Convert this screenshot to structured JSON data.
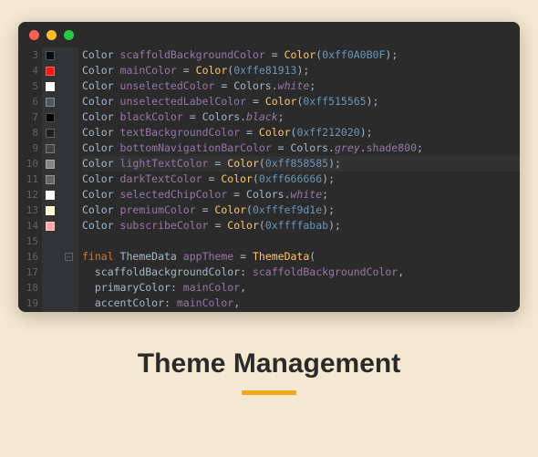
{
  "caption": "Theme Management",
  "lines": [
    {
      "num": "3",
      "swatch": "#0A0B0F",
      "code": [
        {
          "c": "type",
          "t": "Color "
        },
        {
          "c": "ident",
          "t": "scaffoldBackgroundColor"
        },
        {
          "c": "eq",
          "t": " = "
        },
        {
          "c": "call",
          "t": "Color"
        },
        {
          "c": "punc",
          "t": "("
        },
        {
          "c": "num",
          "t": "0xff0A0B0F"
        },
        {
          "c": "punc",
          "t": ");"
        }
      ]
    },
    {
      "num": "4",
      "swatch": "#f81913",
      "code": [
        {
          "c": "type",
          "t": "Color "
        },
        {
          "c": "ident",
          "t": "mainColor"
        },
        {
          "c": "eq",
          "t": " = "
        },
        {
          "c": "call",
          "t": "Color"
        },
        {
          "c": "punc",
          "t": "("
        },
        {
          "c": "num",
          "t": "0xffe81913"
        },
        {
          "c": "punc",
          "t": ");"
        }
      ]
    },
    {
      "num": "5",
      "swatch": "#ffffff",
      "code": [
        {
          "c": "type",
          "t": "Color "
        },
        {
          "c": "ident",
          "t": "unselectedColor"
        },
        {
          "c": "eq",
          "t": " = "
        },
        {
          "c": "obj",
          "t": "Colors."
        },
        {
          "c": "prop",
          "t": "white"
        },
        {
          "c": "punc",
          "t": ";"
        }
      ]
    },
    {
      "num": "6",
      "swatch": "#515565",
      "code": [
        {
          "c": "type",
          "t": "Color "
        },
        {
          "c": "ident",
          "t": "unselectedLabelColor"
        },
        {
          "c": "eq",
          "t": " = "
        },
        {
          "c": "call",
          "t": "Color"
        },
        {
          "c": "punc",
          "t": "("
        },
        {
          "c": "num",
          "t": "0xff515565"
        },
        {
          "c": "punc",
          "t": ");"
        }
      ]
    },
    {
      "num": "7",
      "swatch": "#000000",
      "code": [
        {
          "c": "type",
          "t": "Color "
        },
        {
          "c": "ident",
          "t": "blackColor"
        },
        {
          "c": "eq",
          "t": " = "
        },
        {
          "c": "obj",
          "t": "Colors."
        },
        {
          "c": "prop",
          "t": "black"
        },
        {
          "c": "punc",
          "t": ";"
        }
      ]
    },
    {
      "num": "8",
      "swatch": "#212020",
      "code": [
        {
          "c": "type",
          "t": "Color "
        },
        {
          "c": "ident",
          "t": "textBackgroundColor"
        },
        {
          "c": "eq",
          "t": " = "
        },
        {
          "c": "call",
          "t": "Color"
        },
        {
          "c": "punc",
          "t": "("
        },
        {
          "c": "num",
          "t": "0xff212020"
        },
        {
          "c": "punc",
          "t": ");"
        }
      ]
    },
    {
      "num": "9",
      "swatch": "#424242",
      "code": [
        {
          "c": "type",
          "t": "Color "
        },
        {
          "c": "ident",
          "t": "bottomNavigationBarColor"
        },
        {
          "c": "eq",
          "t": " = "
        },
        {
          "c": "obj",
          "t": "Colors."
        },
        {
          "c": "prop",
          "t": "grey"
        },
        {
          "c": "obj",
          "t": "."
        },
        {
          "c": "ident",
          "t": "shade800"
        },
        {
          "c": "punc",
          "t": ";"
        }
      ]
    },
    {
      "num": "10",
      "swatch": "#858585",
      "hl": true,
      "code": [
        {
          "c": "type",
          "t": "Color "
        },
        {
          "c": "ident",
          "t": "lightTextColor"
        },
        {
          "c": "eq",
          "t": " = "
        },
        {
          "c": "call",
          "t": "Color"
        },
        {
          "c": "punc",
          "t": "("
        },
        {
          "c": "num",
          "t": "0xff858585"
        },
        {
          "c": "punc",
          "t": ");"
        }
      ]
    },
    {
      "num": "11",
      "swatch": "#666666",
      "code": [
        {
          "c": "type",
          "t": "Color "
        },
        {
          "c": "ident",
          "t": "darkTextColor"
        },
        {
          "c": "eq",
          "t": " = "
        },
        {
          "c": "call",
          "t": "Color"
        },
        {
          "c": "punc",
          "t": "("
        },
        {
          "c": "num",
          "t": "0xff666666"
        },
        {
          "c": "punc",
          "t": ");"
        }
      ]
    },
    {
      "num": "12",
      "swatch": "#ffffff",
      "code": [
        {
          "c": "type",
          "t": "Color "
        },
        {
          "c": "ident",
          "t": "selectedChipColor"
        },
        {
          "c": "eq",
          "t": " = "
        },
        {
          "c": "obj",
          "t": "Colors."
        },
        {
          "c": "prop",
          "t": "white"
        },
        {
          "c": "punc",
          "t": ";"
        }
      ]
    },
    {
      "num": "13",
      "swatch": "#fef9d1",
      "code": [
        {
          "c": "type",
          "t": "Color "
        },
        {
          "c": "ident",
          "t": "premiumColor"
        },
        {
          "c": "eq",
          "t": " = "
        },
        {
          "c": "call",
          "t": "Color"
        },
        {
          "c": "punc",
          "t": "("
        },
        {
          "c": "num",
          "t": "0xfffef9d1e"
        },
        {
          "c": "punc",
          "t": ");"
        }
      ]
    },
    {
      "num": "14",
      "swatch": "#ffabab",
      "code": [
        {
          "c": "type",
          "t": "Color "
        },
        {
          "c": "ident",
          "t": "subscribeColor"
        },
        {
          "c": "eq",
          "t": " = "
        },
        {
          "c": "call",
          "t": "Color"
        },
        {
          "c": "punc",
          "t": "("
        },
        {
          "c": "num",
          "t": "0xffffabab"
        },
        {
          "c": "punc",
          "t": ");"
        }
      ]
    },
    {
      "num": "15",
      "swatch": null,
      "code": [
        {
          "c": "punc",
          "t": ""
        }
      ]
    },
    {
      "num": "16",
      "swatch": null,
      "fold": true,
      "code": [
        {
          "c": "kw",
          "t": "final "
        },
        {
          "c": "type",
          "t": "ThemeData "
        },
        {
          "c": "ident",
          "t": "appTheme"
        },
        {
          "c": "eq",
          "t": " = "
        },
        {
          "c": "call",
          "t": "ThemeData"
        },
        {
          "c": "punc",
          "t": "("
        }
      ]
    },
    {
      "num": "17",
      "swatch": null,
      "code": [
        {
          "c": "punc",
          "t": "  "
        },
        {
          "c": "param",
          "t": "scaffoldBackgroundColor: "
        },
        {
          "c": "ident",
          "t": "scaffoldBackgroundColor"
        },
        {
          "c": "punc",
          "t": ","
        }
      ]
    },
    {
      "num": "18",
      "swatch": null,
      "code": [
        {
          "c": "punc",
          "t": "  "
        },
        {
          "c": "param",
          "t": "primaryColor: "
        },
        {
          "c": "ident",
          "t": "mainColor"
        },
        {
          "c": "punc",
          "t": ","
        }
      ]
    },
    {
      "num": "19",
      "swatch": null,
      "code": [
        {
          "c": "punc",
          "t": "  "
        },
        {
          "c": "param",
          "t": "accentColor: "
        },
        {
          "c": "ident",
          "t": "mainColor"
        },
        {
          "c": "punc",
          "t": ","
        }
      ]
    }
  ]
}
